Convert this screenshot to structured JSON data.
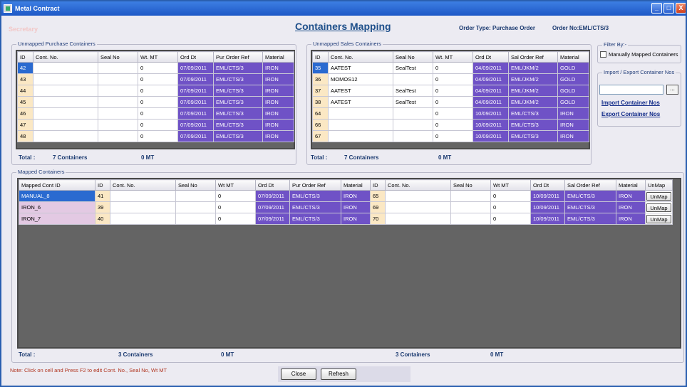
{
  "window": {
    "title": "Metal Contract",
    "min": "_",
    "max": "□",
    "close": "X"
  },
  "ghost_text": "Secretary",
  "page_title": "Containers Mapping",
  "order_type": "Order Type: Purchase Order",
  "order_no": "Order No:EML/CTS/3",
  "unmapped_purchase": {
    "label": "Unmapped Purchase Containers",
    "headers": [
      "ID",
      "Cont. No.",
      "Seal No",
      "Wt. MT",
      "Ord Dt",
      "Pur Order Ref",
      "Material"
    ],
    "rows": [
      [
        "42",
        "",
        "",
        "0",
        "07/09/2011",
        "EML/CTS/3",
        "IRON"
      ],
      [
        "43",
        "",
        "",
        "0",
        "07/09/2011",
        "EML/CTS/3",
        "IRON"
      ],
      [
        "44",
        "",
        "",
        "0",
        "07/09/2011",
        "EML/CTS/3",
        "IRON"
      ],
      [
        "45",
        "",
        "",
        "0",
        "07/09/2011",
        "EML/CTS/3",
        "IRON"
      ],
      [
        "46",
        "",
        "",
        "0",
        "07/09/2011",
        "EML/CTS/3",
        "IRON"
      ],
      [
        "47",
        "",
        "",
        "0",
        "07/09/2011",
        "EML/CTS/3",
        "IRON"
      ],
      [
        "48",
        "",
        "",
        "0",
        "07/09/2011",
        "EML/CTS/3",
        "IRON"
      ]
    ],
    "total_label": "Total :",
    "total_count": "7 Containers",
    "total_wt": "0 MT"
  },
  "unmapped_sales": {
    "label": "Unmapped Sales Containers",
    "headers": [
      "ID",
      "Cont. No.",
      "Seal No",
      "Wt. MT",
      "Ord Dt",
      "Sal Order Ref",
      "Material"
    ],
    "rows": [
      [
        "35",
        "AATEST",
        "SealTest",
        "0",
        "04/09/2011",
        "EML/JKM/2",
        "GOLD"
      ],
      [
        "36",
        "MOMOS12",
        "",
        "0",
        "04/09/2011",
        "EML/JKM/2",
        "GOLD"
      ],
      [
        "37",
        "AATEST",
        "SealTest",
        "0",
        "04/09/2011",
        "EML/JKM/2",
        "GOLD"
      ],
      [
        "38",
        "AATEST",
        "SealTest",
        "0",
        "04/09/2011",
        "EML/JKM/2",
        "GOLD"
      ],
      [
        "64",
        "",
        "",
        "0",
        "10/09/2011",
        "EML/CTS/3",
        "IRON"
      ],
      [
        "66",
        "",
        "",
        "0",
        "10/09/2011",
        "EML/CTS/3",
        "IRON"
      ],
      [
        "67",
        "",
        "",
        "0",
        "10/09/2011",
        "EML/CTS/3",
        "IRON"
      ]
    ],
    "total_label": "Total :",
    "total_count": "7 Containers",
    "total_wt": "0 MT"
  },
  "filter": {
    "label": "Filter By:-",
    "checkbox_label": "Manually Mapped Containers"
  },
  "import_export": {
    "label": "Import / Export Container Nos",
    "browse": "...",
    "import_link": "Import Container Nos",
    "export_link": "Export Container Nos"
  },
  "mapped": {
    "label": "Mapped Containers",
    "headers": [
      "Mapped Cont ID",
      "ID",
      "Cont. No.",
      "Seal No",
      "Wt MT",
      "Ord Dt",
      "Pur Order Ref",
      "Material",
      "ID",
      "Cont. No.",
      "Seal No",
      "Wt MT",
      "Ord Dt",
      "Sal Order Ref",
      "Material",
      "UnMap"
    ],
    "rows": [
      [
        "MANUAL_8",
        "41",
        "",
        "",
        "0",
        "07/09/2011",
        "EML/CTS/3",
        "IRON",
        "65",
        "",
        "",
        "0",
        "10/09/2011",
        "EML/CTS/3",
        "IRON",
        "UnMap"
      ],
      [
        "IRON_6",
        "39",
        "",
        "",
        "0",
        "07/09/2011",
        "EML/CTS/3",
        "IRON",
        "69",
        "",
        "",
        "0",
        "10/09/2011",
        "EML/CTS/3",
        "IRON",
        "UnMap"
      ],
      [
        "IRON_7",
        "40",
        "",
        "",
        "0",
        "07/09/2011",
        "EML/CTS/3",
        "IRON",
        "70",
        "",
        "",
        "0",
        "10/09/2011",
        "EML/CTS/3",
        "IRON",
        "UnMap"
      ]
    ],
    "total_label": "Total :",
    "pur_count": "3 Containers",
    "pur_wt": "0 MT",
    "sal_count": "3 Containers",
    "sal_wt": "0 MT"
  },
  "note": "Note: Click on cell and Press F2 to edit Cont. No., Seal No, Wt MT",
  "buttons": {
    "close": "Close",
    "refresh": "Refresh"
  },
  "colors": {
    "title_bar": "#1e58c6",
    "row_highlight": "#6f52c6",
    "selection": "#2a6ad0",
    "id_cell": "#fbe8c4",
    "grid_bg": "#646464"
  }
}
